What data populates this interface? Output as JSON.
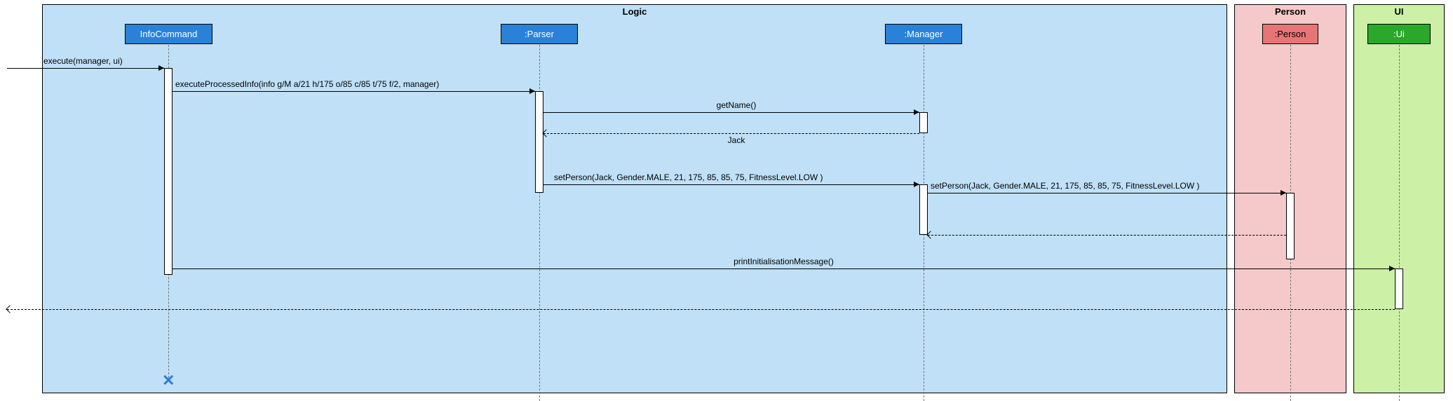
{
  "regions": {
    "logic": {
      "title": "Logic",
      "color_bg": "#bfe0f7",
      "color_item": "#2a82d8"
    },
    "person": {
      "title": "Person",
      "color_bg": "#f5c9c9",
      "color_item": "#e67676"
    },
    "ui": {
      "title": "UI",
      "color_bg": "#ccf0a6",
      "color_item": "#2aa82a"
    }
  },
  "lifelines": {
    "infoCommand": {
      "label": "InfoCommand"
    },
    "parser": {
      "label": ":Parser"
    },
    "manager": {
      "label": ":Manager"
    },
    "person": {
      "label": ":Person"
    },
    "ui": {
      "label": ":Ui"
    }
  },
  "messages": {
    "m1": "execute(manager, ui)",
    "m2": "executeProcessedInfo(info g/M a/21 h/175 o/85 c/85 t/75 f/2, manager)",
    "m3": "getName()",
    "m4": "Jack",
    "m5": "setPerson(Jack, Gender.MALE, 21, 175, 85, 85, 75, FitnessLevel.LOW )",
    "m6": "setPerson(Jack, Gender.MALE, 21, 175, 85, 85, 75, FitnessLevel.LOW )",
    "m7": "printInitialisationMessage()"
  }
}
